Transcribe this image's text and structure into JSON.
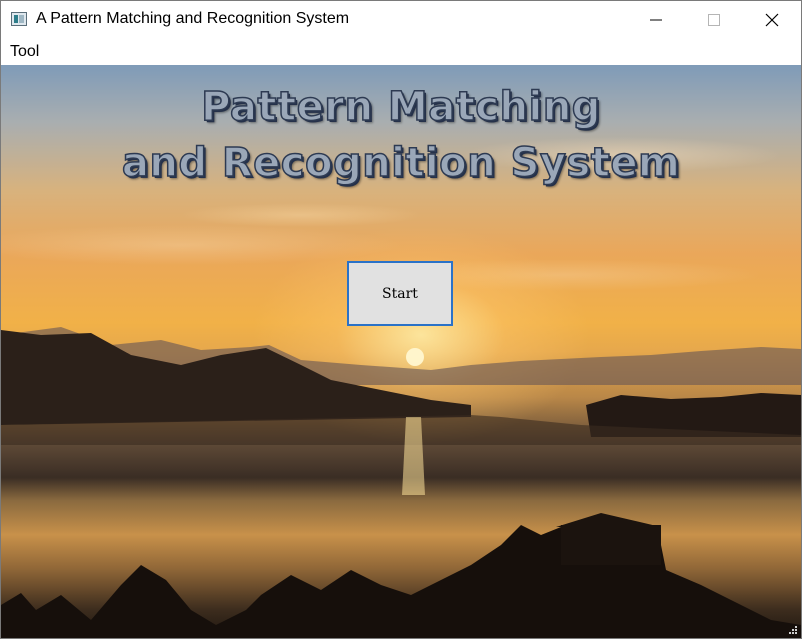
{
  "window": {
    "title": "A Pattern Matching and Recognition System"
  },
  "menu": {
    "items": [
      "Tool"
    ]
  },
  "main": {
    "heading_line1": "Pattern Matching",
    "heading_line2": "and Recognition System",
    "start_label": "Start"
  },
  "icons": {
    "app": "app-icon",
    "minimize": "minimize-icon",
    "maximize": "maximize-icon",
    "close": "close-icon",
    "resize": "resize-grip-icon"
  },
  "colors": {
    "button_border": "#2a72c8",
    "button_fill": "#e1e1e1",
    "heading_fill": "#9aa7b8",
    "heading_outline": "#2d3a52"
  }
}
